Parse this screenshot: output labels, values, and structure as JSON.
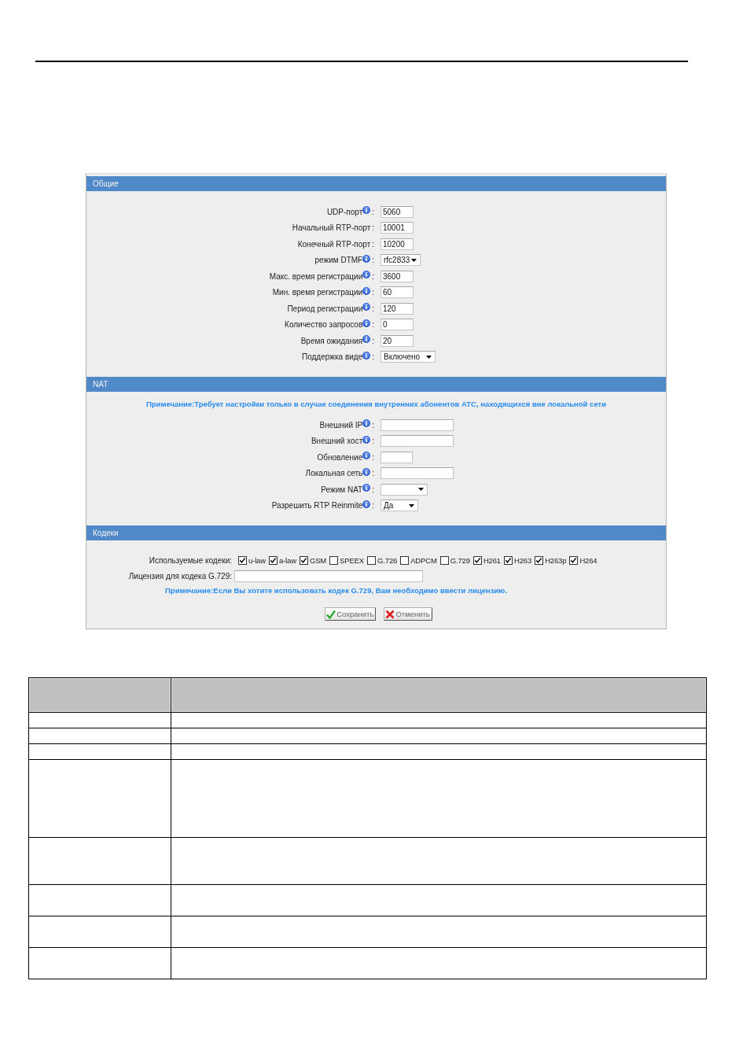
{
  "sections": [
    {
      "kind": "fields",
      "title": "Общие",
      "fields": [
        {
          "label": "UDP-порт",
          "info": true,
          "separator": ":",
          "kind": "text",
          "value": "5060"
        },
        {
          "label": "Начальный RTP-порт",
          "info": false,
          "separator": ":",
          "kind": "text",
          "value": "10001"
        },
        {
          "label": "Конечный RTP-порт",
          "info": false,
          "separator": ":",
          "kind": "text",
          "value": "10200"
        },
        {
          "label": "режим DTMF",
          "info": true,
          "separator": ":",
          "kind": "select",
          "value": "rfc2833"
        },
        {
          "label": "Макс. время регистрации",
          "info": true,
          "separator": ":",
          "kind": "text",
          "value": "3600"
        },
        {
          "label": "Мин. время регистрации",
          "info": true,
          "separator": ":",
          "kind": "text",
          "value": "60"
        },
        {
          "label": "Период регистрации",
          "info": true,
          "separator": ":",
          "kind": "text",
          "value": "120"
        },
        {
          "label": "Количество запросов",
          "info": true,
          "separator": ":",
          "kind": "text",
          "value": "0"
        },
        {
          "label": "Время ожидания",
          "info": true,
          "separator": ":",
          "kind": "text",
          "value": "20"
        },
        {
          "label": "Поддержка виде",
          "info": true,
          "separator": ":",
          "kind": "select",
          "value": "Включено"
        }
      ]
    },
    {
      "kind": "fields",
      "title": "NAT",
      "note": "Примечание:Требует настройки только в случае соединения внутренних абонентов АТС, находящихся вне локальной сети",
      "fields": [
        {
          "label": "Внешний IP",
          "info": true,
          "separator": ":",
          "kind": "text"
        },
        {
          "label": "Внешний хост",
          "info": true,
          "separator": ":",
          "kind": "text"
        },
        {
          "label": "Обновление",
          "info": true,
          "separator": ":",
          "kind": "text"
        },
        {
          "label": "Локальная сеть",
          "info": true,
          "separator": ":",
          "kind": "text"
        },
        {
          "label": "Режим NAT",
          "info": true,
          "separator": ":",
          "kind": "select"
        },
        {
          "label": "Разрешить RTP Reinmite",
          "info": true,
          "separator": ":",
          "kind": "select",
          "value": "Да"
        }
      ]
    },
    {
      "kind": "codecs",
      "title": "Кодеки",
      "codecs_label": "Используемые кодеки:",
      "codecs": [
        {
          "label": "u-law",
          "checked": true
        },
        {
          "label": "a-law",
          "checked": true
        },
        {
          "label": "GSM",
          "checked": true
        },
        {
          "label": "SPEEX",
          "checked": false
        },
        {
          "label": "G.726",
          "checked": false
        },
        {
          "label": "ADPCM",
          "checked": false
        },
        {
          "label": "G.729",
          "checked": false
        },
        {
          "label": "H261",
          "checked": true
        },
        {
          "label": "H263",
          "checked": true
        },
        {
          "label": "H263p",
          "checked": true
        },
        {
          "label": "H264",
          "checked": true
        }
      ],
      "license_label": "Лицензия для кодека G.729:",
      "note": "Примечание:Если Вы хотите использовать кодек G.729, Вам необходимо ввести лицензию.",
      "buttons": [
        {
          "label": "Сохранить",
          "kind": "save"
        },
        {
          "label": "Отменить",
          "kind": "cancel"
        }
      ]
    }
  ]
}
